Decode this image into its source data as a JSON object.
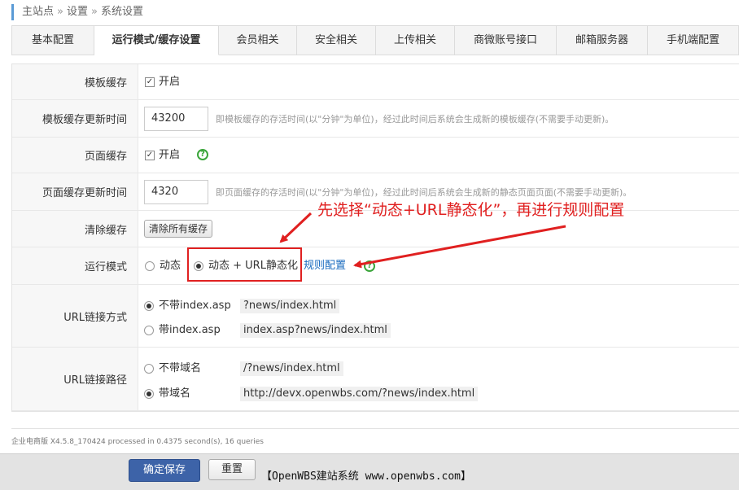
{
  "breadcrumb": {
    "items": [
      "主站点",
      "设置",
      "系统设置"
    ],
    "separator": "»"
  },
  "tabs": [
    {
      "label": "基本配置",
      "active": false
    },
    {
      "label": "运行模式/缓存设置",
      "active": true
    },
    {
      "label": "会员相关",
      "active": false
    },
    {
      "label": "安全相关",
      "active": false
    },
    {
      "label": "上传相关",
      "active": false
    },
    {
      "label": "商微账号接口",
      "active": false
    },
    {
      "label": "邮箱服务器",
      "active": false
    },
    {
      "label": "手机端配置",
      "active": false
    }
  ],
  "form": {
    "template_cache": {
      "label": "模板缓存",
      "checkbox_label": "开启",
      "checked": true
    },
    "template_cache_time": {
      "label": "模板缓存更新时间",
      "value": "43200",
      "hint": "即模板缓存的存活时间(以\"分钟\"为单位)，经过此时间后系统会生成新的模板缓存(不需要手动更新)。"
    },
    "page_cache": {
      "label": "页面缓存",
      "checkbox_label": "开启",
      "checked": true,
      "help_icon": "question-icon"
    },
    "page_cache_time": {
      "label": "页面缓存更新时间",
      "value": "4320",
      "hint": "即页面缓存的存活时间(以\"分钟\"为单位)，经过此时间后系统会生成新的静态页面页面(不需要手动更新)。"
    },
    "clear_cache": {
      "label": "清除缓存",
      "button": "清除所有缓存"
    },
    "run_mode": {
      "label": "运行模式",
      "options": [
        "动态",
        "动态 + URL静态化"
      ],
      "selected": 1,
      "rule_link": "规则配置",
      "help_icon": "question-icon"
    },
    "url_mode": {
      "label": "URL链接方式",
      "options": [
        {
          "label": "不带index.asp",
          "example": "?news/index.html"
        },
        {
          "label": "带index.asp",
          "example": "index.asp?news/index.html"
        }
      ],
      "selected": 0
    },
    "url_path": {
      "label": "URL链接路径",
      "options": [
        {
          "label": "不带域名",
          "example": "/?news/index.html"
        },
        {
          "label": "带域名",
          "example": "http://devx.openwbs.com/?news/index.html"
        }
      ],
      "selected": 1
    }
  },
  "annotation": {
    "text": "先选择“动态+URL静态化”，再进行规则配置",
    "color": "#e02020"
  },
  "footer": {
    "note": "企业电商版 X4.5.8_170424 processed in 0.4375 second(s), 16 queries"
  },
  "actions": {
    "save": "确定保存",
    "reset": "重置",
    "credit": "【OpenWBS建站系统 www.openwbs.com】"
  },
  "colors": {
    "primary": "#3d63a8",
    "link": "#1a6bbf",
    "help": "#3aa53a",
    "accent_bar": "#5a9bd6"
  }
}
